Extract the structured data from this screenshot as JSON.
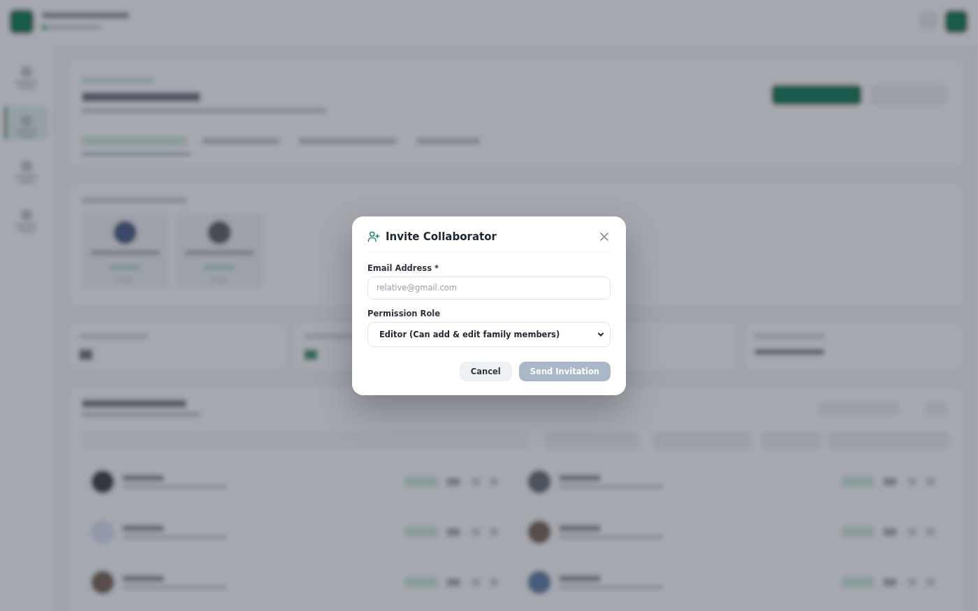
{
  "dialog": {
    "title": "Invite Collaborator",
    "fields": [
      {
        "kind": "input",
        "label": "Email Address *",
        "placeholder": "relative@gmail.com"
      },
      {
        "kind": "select",
        "label": "Permission Role",
        "value": "Editor (Can add & edit family members)"
      }
    ],
    "buttons": [
      {
        "label": "Cancel",
        "disabled": false
      },
      {
        "label": "Send Invitation",
        "disabled": true
      }
    ]
  }
}
